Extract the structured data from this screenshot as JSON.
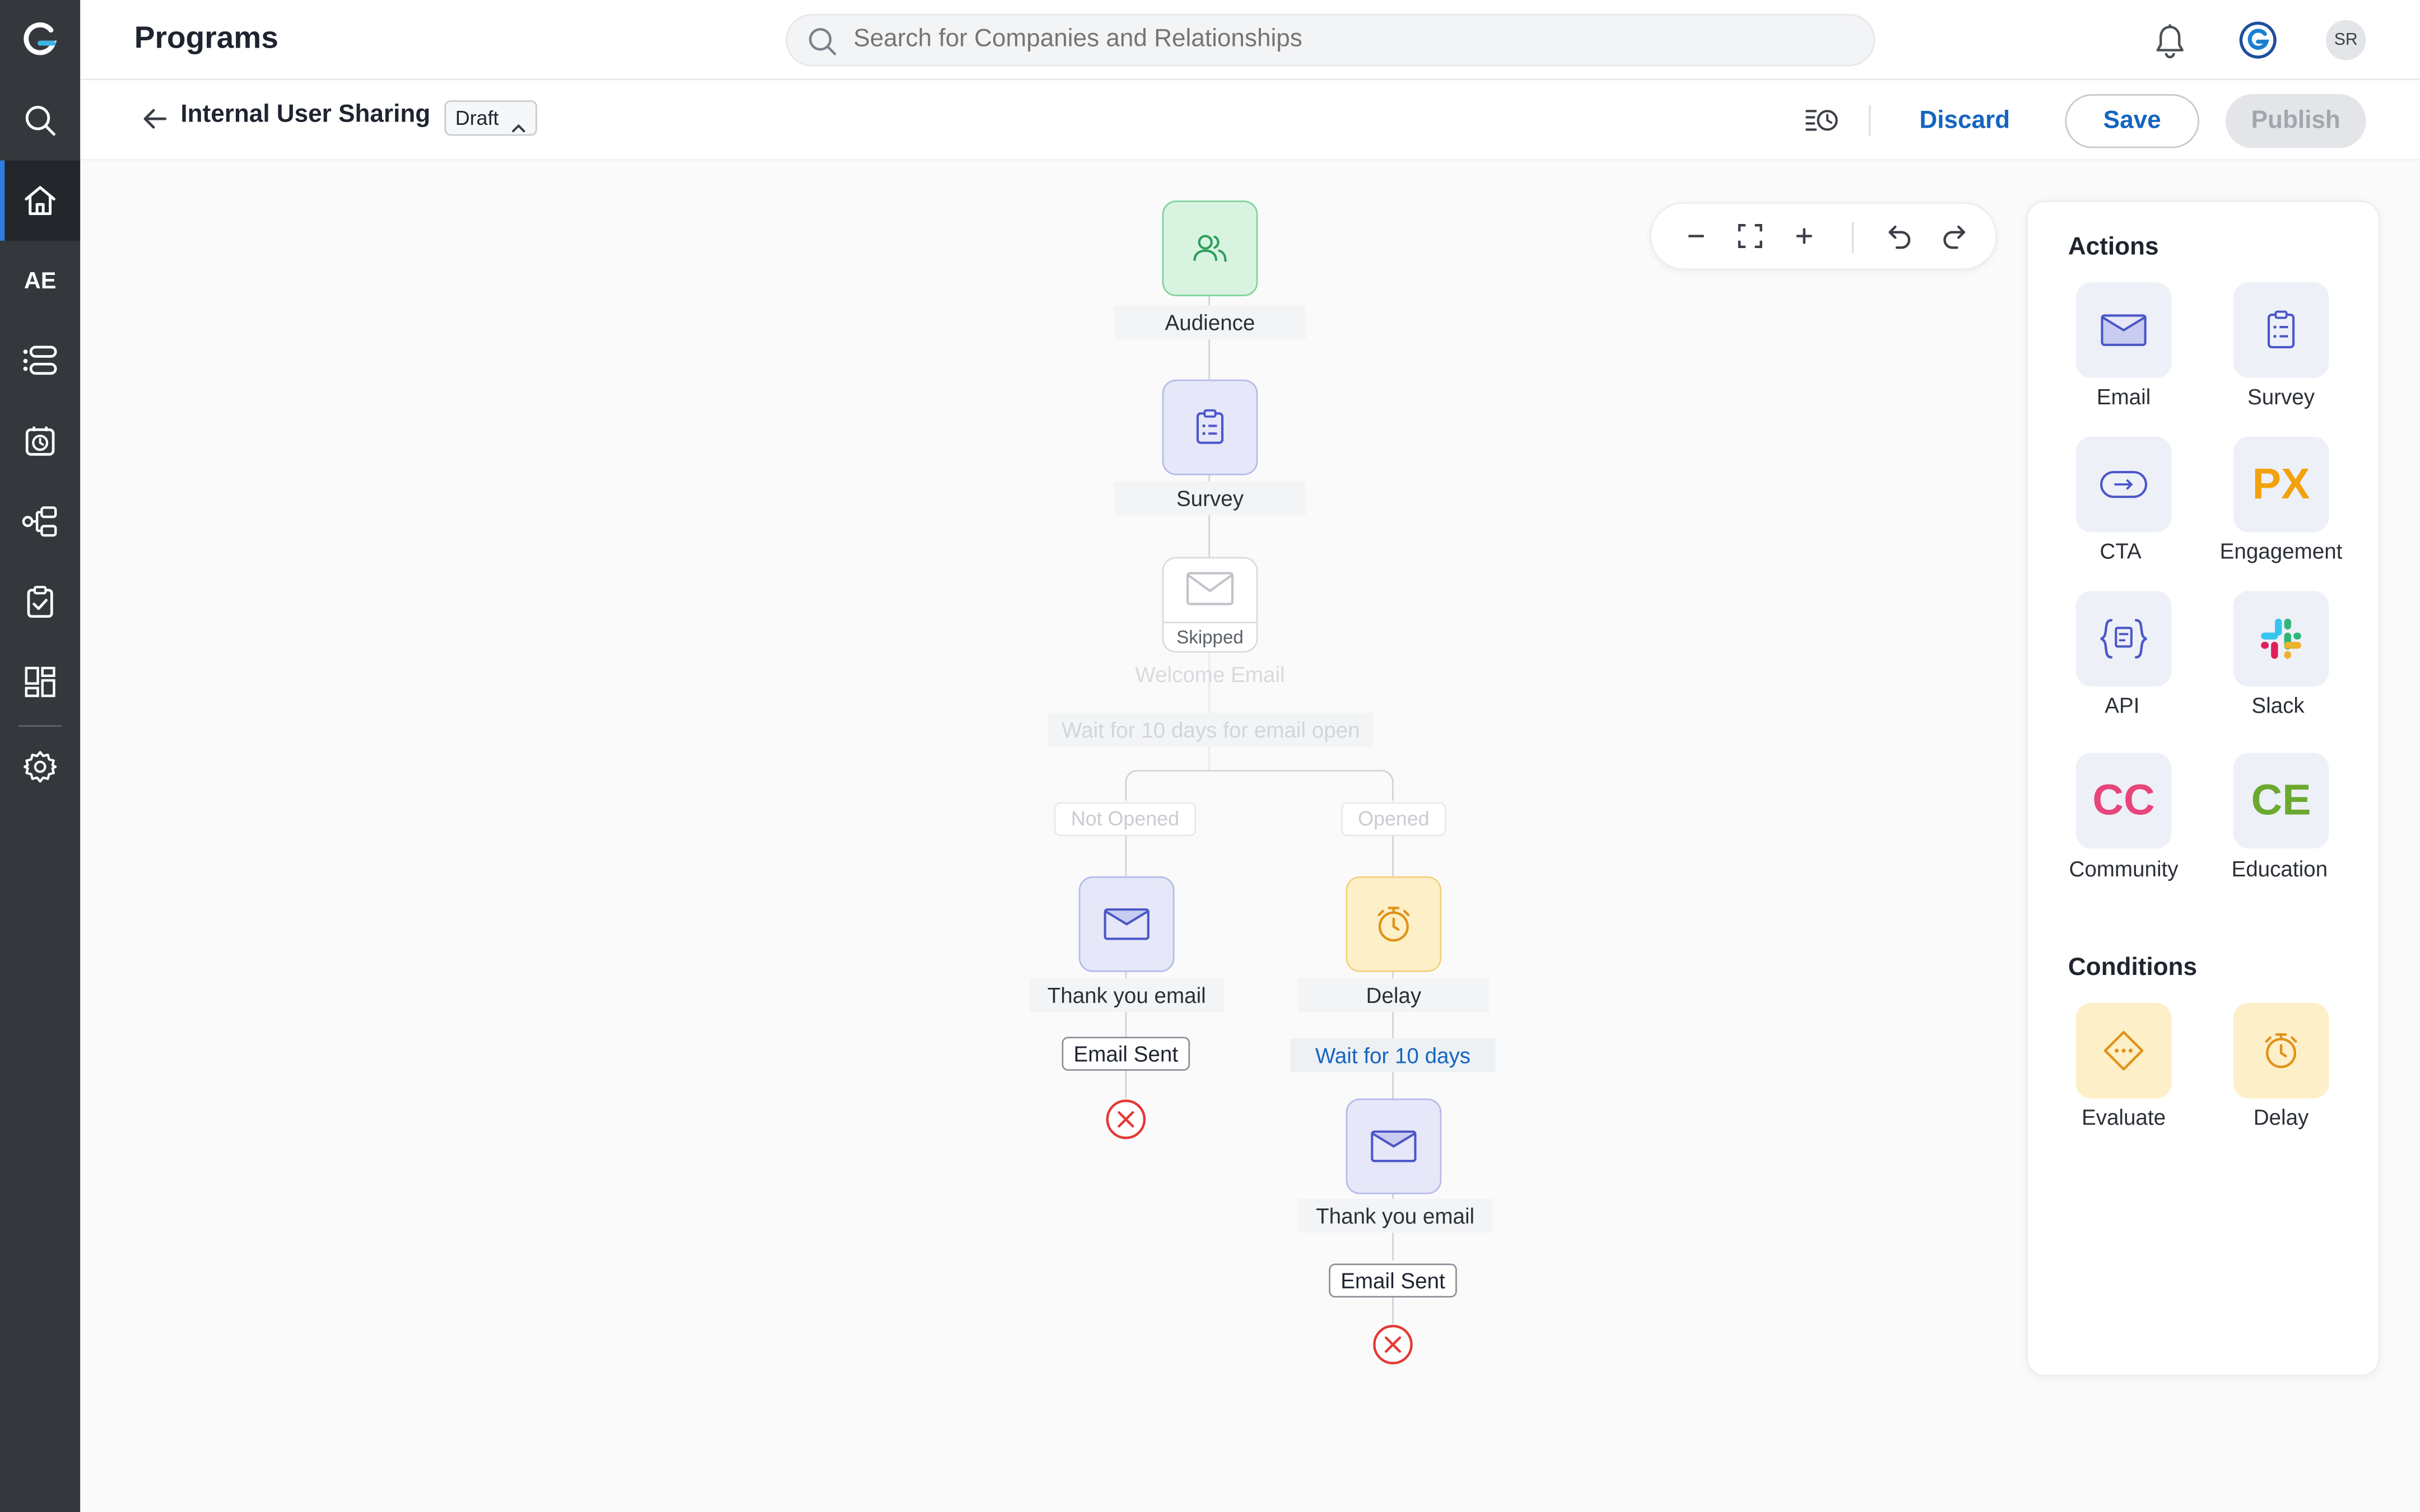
{
  "header": {
    "title": "Programs",
    "search_placeholder": "Search for Companies and Relationships",
    "avatar_initials": "SR"
  },
  "nav": {
    "ae_label": "AE"
  },
  "program": {
    "name": "Internal User Sharing",
    "status": "Draft"
  },
  "toolbar": {
    "discard": "Discard",
    "save": "Save",
    "publish": "Publish"
  },
  "flow": {
    "audience": "Audience",
    "survey": "Survey",
    "skipped_badge": "Skipped",
    "welcome_email": "Welcome Email",
    "wait_condition": "Wait for 10 days for email open",
    "branch_not_opened": "Not Opened",
    "branch_opened": "Opened",
    "left_email": "Thank you email",
    "left_status": "Email Sent",
    "delay": "Delay",
    "delay_wait": "Wait for 10 days",
    "right_email": "Thank you email",
    "right_status": "Email Sent"
  },
  "panel": {
    "actions_title": "Actions",
    "actions": [
      "Email",
      "Survey",
      "CTA",
      "Engagement",
      "API",
      "Slack",
      "Community",
      "Education"
    ],
    "engagement_text": "PX",
    "community_text": "CC",
    "education_text": "CE",
    "conditions_title": "Conditions",
    "conditions": [
      "Evaluate",
      "Delay"
    ]
  },
  "colors": {
    "accent": "#1565c0",
    "nav_bg": "#34383d",
    "audience_bg": "#d8f4e0",
    "email_bg": "#e6e7f8",
    "delay_bg": "#fdefc8",
    "error": "#e53935",
    "px": "#f2a20c",
    "cc": "#e8457a",
    "ce": "#6aa82e"
  }
}
